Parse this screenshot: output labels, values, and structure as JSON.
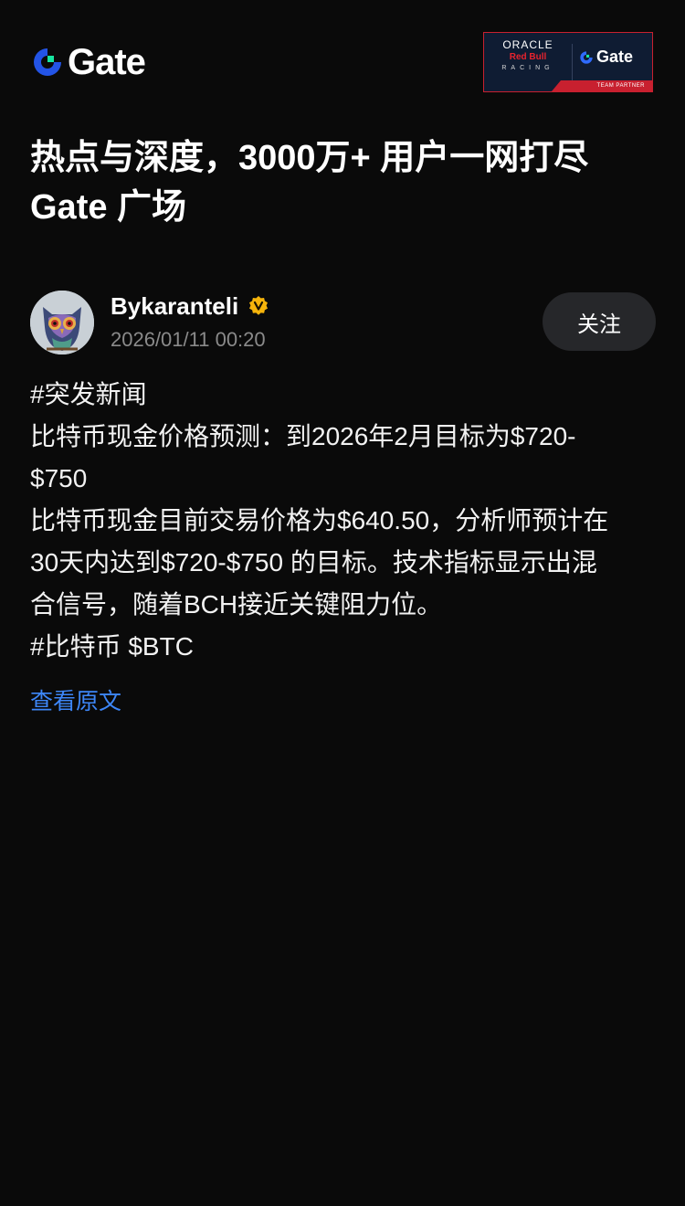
{
  "header": {
    "logo_text": "Gate",
    "partner_badge": {
      "oracle": "ORACLE",
      "redbull": "Red Bull",
      "racing": "RACING",
      "gate_text": "Gate",
      "strip_text": "TEAM PARTNER"
    }
  },
  "headline": {
    "line1": "热点与深度，3000万+ 用户一网打尽",
    "line2": "Gate 广场"
  },
  "author": {
    "name": "Bykaranteli",
    "time": "2026/01/11 00:20",
    "follow_label": "关注",
    "verified_color": "#f6b40b"
  },
  "post": {
    "lines": [
      "#突发新闻",
      "比特币现金价格预测：到2026年2月目标为$720-",
      "$750",
      "比特币现金目前交易价格为$640.50，分析师预计在",
      "30天内达到$720-$750 的目标。技术指标显示出混",
      "合信号，随着BCH接近关键阻力位。",
      "#比特币 $BTC"
    ]
  },
  "view_original_label": "查看原文",
  "colors": {
    "background": "#0a0a0a",
    "accent": "#3d86f7",
    "gate_blue": "#2354e6",
    "gate_green": "#17e6a1"
  }
}
